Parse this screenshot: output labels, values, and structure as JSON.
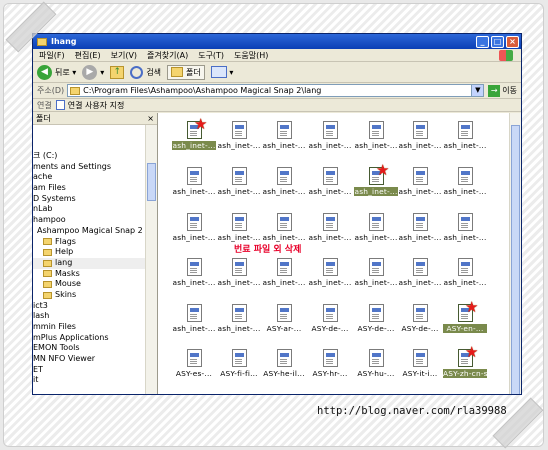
{
  "window": {
    "title": "Ihang",
    "controls": [
      "_",
      "□",
      "×"
    ]
  },
  "menu": [
    "파일(F)",
    "편집(E)",
    "보기(V)",
    "즐겨찾기(A)",
    "도구(T)",
    "도움말(H)"
  ],
  "toolbar": {
    "back_label": "뒤로",
    "search_label": "검색",
    "folders_label": "폴더"
  },
  "address": {
    "label": "주소(D)",
    "value": "C:\\Program Files\\Ashampoo\\Ashampoo Magical Snap 2\\lang",
    "go_label": "이동"
  },
  "links": {
    "label": "연결",
    "item": "연결 사용자 지정"
  },
  "tree": {
    "header": "폴더",
    "close": "×",
    "items": [
      "크 (C:)",
      "ments and Settings",
      "ache",
      "am Files",
      "D Systems",
      "nLab",
      "hampoo",
      "Ashampoo Magical Snap 2",
      "Flags",
      "Help",
      "lang",
      "Masks",
      "Mouse",
      "Skins",
      "ict3",
      "lash",
      "mmin Files",
      "mPlus Applications",
      "EMON Tools",
      "MN NFO Viewer",
      "ET",
      "it"
    ]
  },
  "files": {
    "rows": [
      [
        "ash_inet-...",
        "ash_inet-...",
        "ash_inet-...",
        "ash_inet-...",
        "ash_inet-...",
        "ash_inet-...",
        "ash_inet-..."
      ],
      [
        "ash_inet-...",
        "ash_inet-...",
        "ash_inet-...",
        "ash_inet-...",
        "ash_inet-...",
        "ash_inet-...",
        "ash_inet-..."
      ],
      [
        "ash_inet-...",
        "ash_inet-...",
        "ash_inet-...",
        "ash_inet-...",
        "ash_inet-...",
        "ash_inet-...",
        "ash_inet-..."
      ],
      [
        "ash_inet-...",
        "ash_inet-...",
        "ash_inet-...",
        "ash_inet-...",
        "ash_inet-...",
        "ash_inet-...",
        "ash_inet-..."
      ],
      [
        "ash_inet-...",
        "ash_inet-...",
        "ASY-ar-...",
        "ASY-de-...",
        "ASY-de-...",
        "ASY-de-...",
        "ASY-en-..."
      ],
      [
        "ASY-es-...",
        "ASY-fi-fi...",
        "ASY-he-il...",
        "ASY-hr-...",
        "ASY-hu-...",
        "ASY-it-i...",
        "ASY-zh-cn-shang"
      ]
    ],
    "selected": [
      [
        0,
        0
      ],
      [
        1,
        4
      ],
      [
        4,
        6
      ],
      [
        5,
        6
      ]
    ]
  },
  "annotation": "번료 파일 외 삭제",
  "watermark": "http://blog.naver.com/rla39988"
}
